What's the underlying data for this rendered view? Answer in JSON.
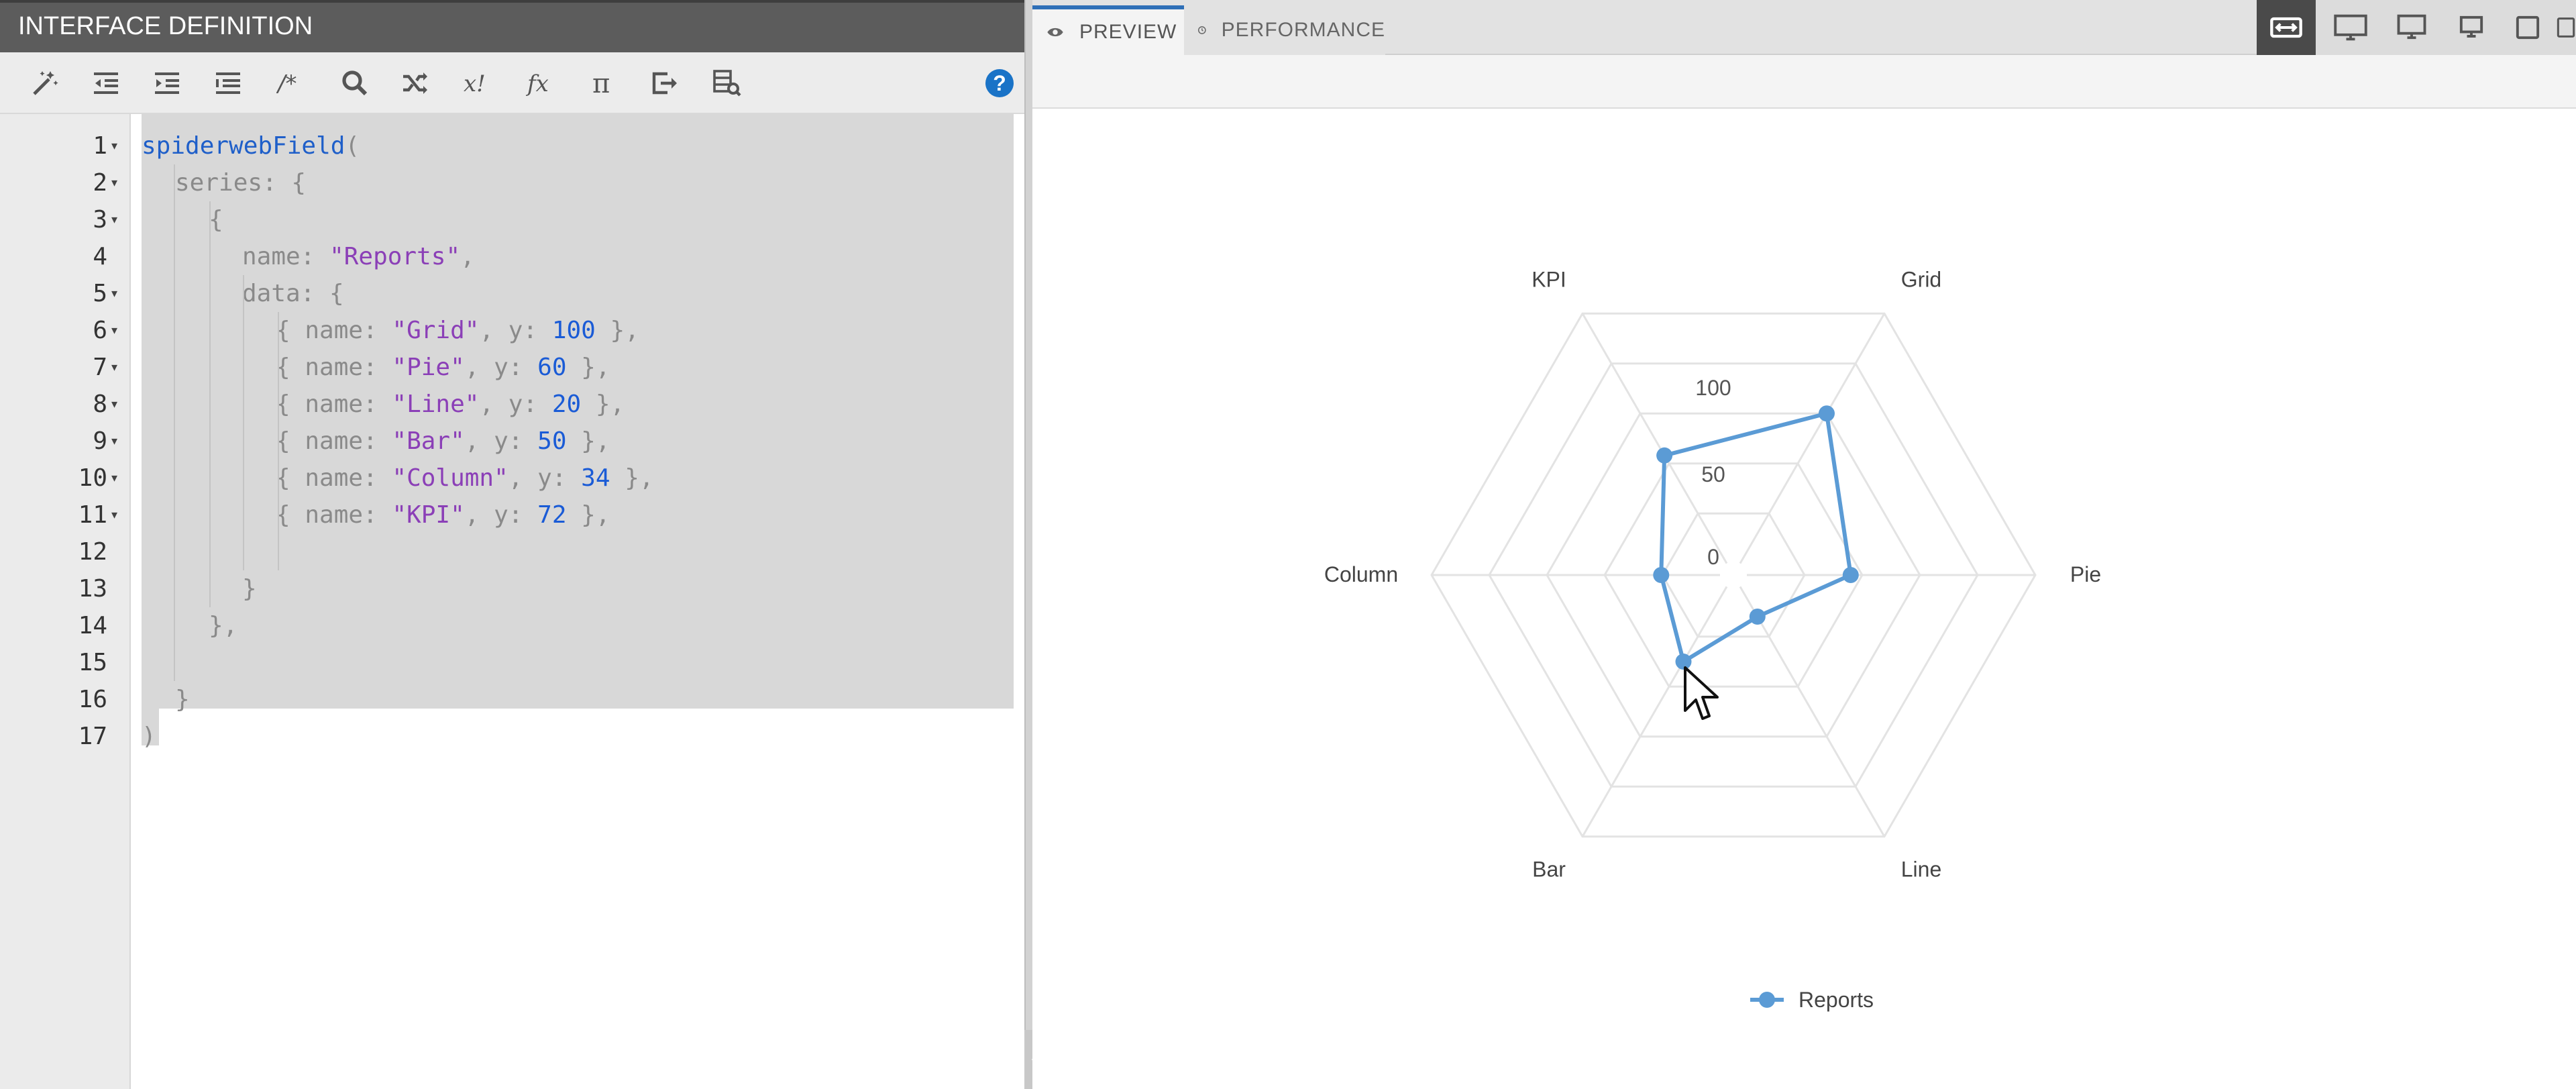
{
  "left_panel": {
    "title": "INTERFACE DEFINITION",
    "toolbar": [
      {
        "name": "format-wand-icon",
        "label": "Format"
      },
      {
        "name": "outdent-icon",
        "label": "Outdent"
      },
      {
        "name": "indent-icon",
        "label": "Indent"
      },
      {
        "name": "align-icon",
        "label": "Align"
      },
      {
        "name": "comment-icon",
        "label": "/*"
      },
      {
        "name": "search-icon",
        "label": "Search"
      },
      {
        "name": "shuffle-icon",
        "label": "Shuffle"
      },
      {
        "name": "expression-icon",
        "label": "x!"
      },
      {
        "name": "function-icon",
        "label": "fx"
      },
      {
        "name": "pi-icon",
        "label": "π"
      },
      {
        "name": "export-icon",
        "label": "Export"
      },
      {
        "name": "data-search-icon",
        "label": "Data"
      }
    ],
    "help_label": "?"
  },
  "code": {
    "line_numbers": [
      "1",
      "2",
      "3",
      "4",
      "5",
      "6",
      "7",
      "8",
      "9",
      "10",
      "11",
      "12",
      "13",
      "14",
      "15",
      "16",
      "17"
    ],
    "fn_name": "spiderwebField",
    "series_key": "series",
    "series_name_key": "name",
    "series_name_value": "\"Reports\"",
    "data_key": "data",
    "rows": [
      {
        "name": "\"Grid\"",
        "y": "100"
      },
      {
        "name": "\"Pie\"",
        "y": "60"
      },
      {
        "name": "\"Line\"",
        "y": "20"
      },
      {
        "name": "\"Bar\"",
        "y": "50"
      },
      {
        "name": "\"Column\"",
        "y": "34"
      },
      {
        "name": "\"KPI\"",
        "y": "72"
      }
    ]
  },
  "right_panel": {
    "tabs": [
      {
        "label": "PREVIEW",
        "icon": "eye-icon",
        "active": true
      },
      {
        "label": "PERFORMANCE",
        "icon": "clock-icon",
        "active": false
      }
    ],
    "devices": [
      "fit-width-icon",
      "desktop-large-icon",
      "desktop-icon",
      "laptop-icon",
      "tablet-icon",
      "phone-icon"
    ]
  },
  "chart_data": {
    "type": "radar",
    "categories": [
      "KPI",
      "Grid",
      "Pie",
      "Line",
      "Bar",
      "Column"
    ],
    "series": [
      {
        "name": "Reports",
        "values": [
          72,
          100,
          60,
          20,
          50,
          34
        ],
        "color": "#5b9bd5"
      }
    ],
    "radial_ticks": [
      "0",
      "50",
      "100"
    ],
    "grid_color": "#e3e3e3",
    "legend": "bottom"
  }
}
